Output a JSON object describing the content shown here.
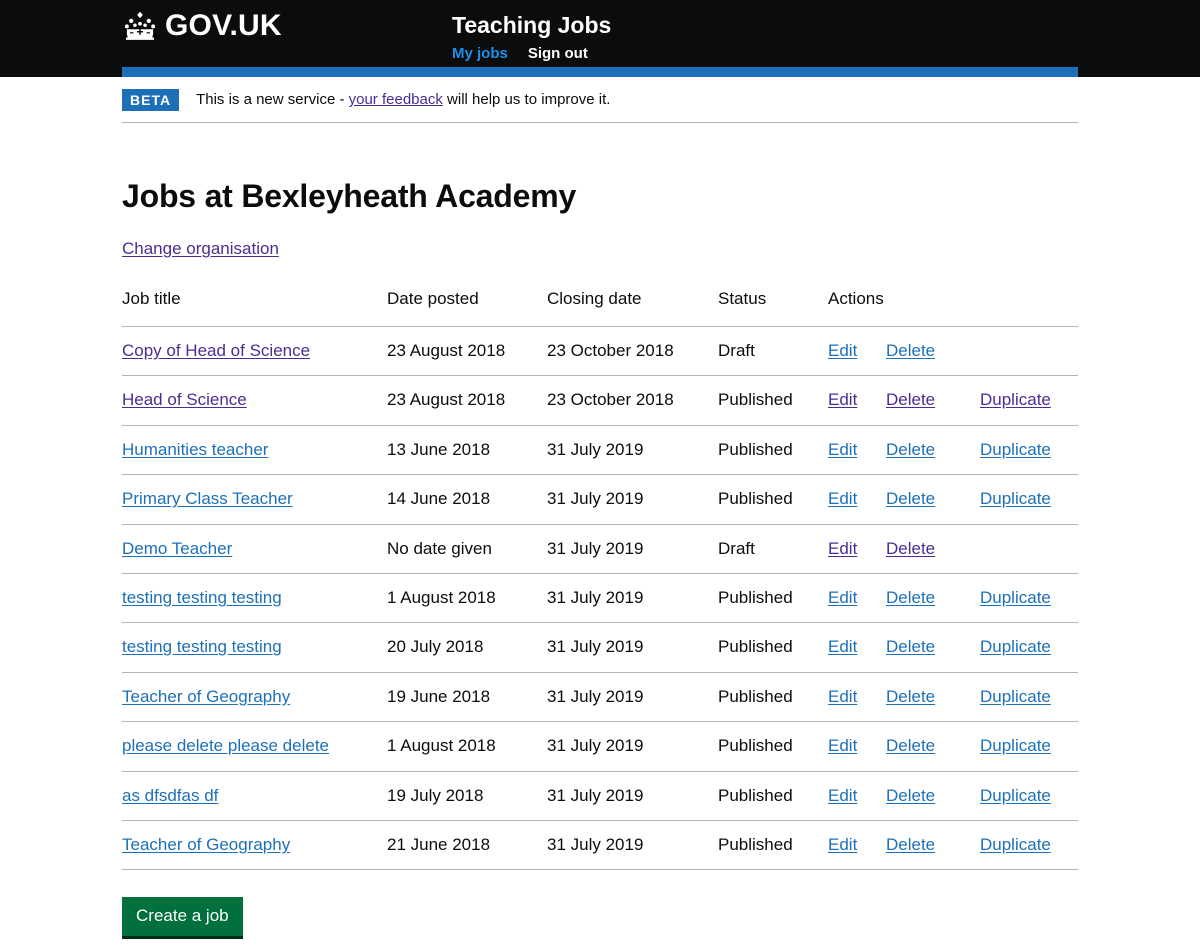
{
  "header": {
    "logo_icon": "crown-icon",
    "brand": "GOV.UK",
    "service_name": "Teaching Jobs",
    "nav": [
      {
        "label": "My jobs",
        "state": "active"
      },
      {
        "label": "Sign out",
        "state": "default"
      }
    ]
  },
  "phase_banner": {
    "tag": "BETA",
    "text_before": "This is a new service - ",
    "link": "your feedback",
    "text_after": " will help us to improve it."
  },
  "main": {
    "page_title": "Jobs at Bexleyheath Academy",
    "change_organisation_link": "Change organisation",
    "create_button": "Create a job"
  },
  "table": {
    "columns": [
      "Job title",
      "Date posted",
      "Closing date",
      "Status",
      "Actions"
    ],
    "action_labels": {
      "edit": "Edit",
      "delete": "Delete",
      "duplicate": "Duplicate"
    },
    "rows": [
      {
        "title": "Copy of Head of Science",
        "title_visited": true,
        "date_posted": "23 August 2018",
        "closing_date": "23 October 2018",
        "status": "Draft",
        "actions": [
          "Edit",
          "Delete"
        ],
        "actions_visited": false
      },
      {
        "title": "Head of Science",
        "title_visited": true,
        "date_posted": "23 August 2018",
        "closing_date": "23 October 2018",
        "status": "Published",
        "actions": [
          "Edit",
          "Delete",
          "Duplicate"
        ],
        "actions_visited": true
      },
      {
        "title": "Humanities teacher",
        "title_visited": false,
        "date_posted": "13 June 2018",
        "closing_date": "31 July 2019",
        "status": "Published",
        "actions": [
          "Edit",
          "Delete",
          "Duplicate"
        ],
        "actions_visited": false
      },
      {
        "title": "Primary Class Teacher",
        "title_visited": false,
        "date_posted": "14 June 2018",
        "closing_date": "31 July 2019",
        "status": "Published",
        "actions": [
          "Edit",
          "Delete",
          "Duplicate"
        ],
        "actions_visited": false
      },
      {
        "title": "Demo Teacher",
        "title_visited": false,
        "date_posted": "No date given",
        "closing_date": "31 July 2019",
        "status": "Draft",
        "actions": [
          "Edit",
          "Delete"
        ],
        "actions_visited": true
      },
      {
        "title": "testing testing testing",
        "title_visited": false,
        "date_posted": "1 August 2018",
        "closing_date": "31 July 2019",
        "status": "Published",
        "actions": [
          "Edit",
          "Delete",
          "Duplicate"
        ],
        "actions_visited": false
      },
      {
        "title": "testing testing testing",
        "title_visited": false,
        "date_posted": "20 July 2018",
        "closing_date": "31 July 2019",
        "status": "Published",
        "actions": [
          "Edit",
          "Delete",
          "Duplicate"
        ],
        "actions_visited": false
      },
      {
        "title": "Teacher of Geography",
        "title_visited": false,
        "date_posted": "19 June 2018",
        "closing_date": "31 July 2019",
        "status": "Published",
        "actions": [
          "Edit",
          "Delete",
          "Duplicate"
        ],
        "actions_visited": false
      },
      {
        "title": "please delete please delete",
        "title_visited": false,
        "date_posted": "1 August 2018",
        "closing_date": "31 July 2019",
        "status": "Published",
        "actions": [
          "Edit",
          "Delete",
          "Duplicate"
        ],
        "actions_visited": false
      },
      {
        "title": "as dfsdfas df",
        "title_visited": false,
        "date_posted": "19 July 2018",
        "closing_date": "31 July 2019",
        "status": "Published",
        "actions": [
          "Edit",
          "Delete",
          "Duplicate"
        ],
        "actions_visited": false
      },
      {
        "title": "Teacher of Geography",
        "title_visited": false,
        "date_posted": "21 June 2018",
        "closing_date": "31 July 2019",
        "status": "Published",
        "actions": [
          "Edit",
          "Delete",
          "Duplicate"
        ],
        "actions_visited": false
      }
    ]
  },
  "colors": {
    "black": "#0b0c0c",
    "blue": "#1d70b8",
    "nav_active_blue": "#1d8feb",
    "visited_purple": "#4c2c92",
    "green": "#00703c",
    "border_grey": "#b1b4b6"
  }
}
